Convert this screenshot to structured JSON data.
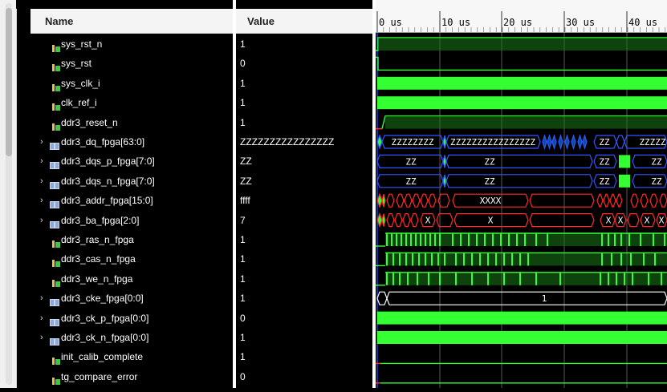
{
  "columns": {
    "name": "Name",
    "value": "Value"
  },
  "timeline": {
    "labels": [
      "0 us",
      "10 us",
      "20 us",
      "30 us",
      "40 us"
    ]
  },
  "signals": [
    {
      "name": "sys_rst_n",
      "value": "1",
      "kind": "bit",
      "expandable": false
    },
    {
      "name": "sys_rst",
      "value": "0",
      "kind": "bit",
      "expandable": false
    },
    {
      "name": "sys_clk_i",
      "value": "1",
      "kind": "bit",
      "expandable": false
    },
    {
      "name": "clk_ref_i",
      "value": "1",
      "kind": "bit",
      "expandable": false
    },
    {
      "name": "ddr3_reset_n",
      "value": "1",
      "kind": "bit",
      "expandable": false
    },
    {
      "name": "ddr3_dq_fpga[63:0]",
      "value": "ZZZZZZZZZZZZZZZZ",
      "kind": "bus",
      "expandable": true
    },
    {
      "name": "ddr3_dqs_p_fpga[7:0]",
      "value": "ZZ",
      "kind": "bus",
      "expandable": true
    },
    {
      "name": "ddr3_dqs_n_fpga[7:0]",
      "value": "ZZ",
      "kind": "bus",
      "expandable": true
    },
    {
      "name": "ddr3_addr_fpga[15:0]",
      "value": "ffff",
      "kind": "bus",
      "expandable": true
    },
    {
      "name": "ddr3_ba_fpga[2:0]",
      "value": "7",
      "kind": "bus",
      "expandable": true
    },
    {
      "name": "ddr3_ras_n_fpga",
      "value": "1",
      "kind": "bit",
      "expandable": false
    },
    {
      "name": "ddr3_cas_n_fpga",
      "value": "1",
      "kind": "bit",
      "expandable": false
    },
    {
      "name": "ddr3_we_n_fpga",
      "value": "1",
      "kind": "bit",
      "expandable": false
    },
    {
      "name": "ddr3_cke_fpga[0:0]",
      "value": "1",
      "kind": "bus",
      "expandable": true
    },
    {
      "name": "ddr3_ck_p_fpga[0:0]",
      "value": "0",
      "kind": "bus",
      "expandable": true
    },
    {
      "name": "ddr3_ck_n_fpga[0:0]",
      "value": "1",
      "kind": "bus",
      "expandable": true
    },
    {
      "name": "init_calib_complete",
      "value": "1",
      "kind": "bit",
      "expandable": false
    },
    {
      "name": "tg_compare_error",
      "value": "0",
      "kind": "bit",
      "expandable": false
    }
  ],
  "wave_labels": {
    "dq": [
      "ZZZZZZZZ",
      "ZZZZZZZZZZZZZZZZ",
      "ZZ",
      "ZZZZZ"
    ],
    "dqs_p": [
      "ZZ",
      "ZZ",
      "ZZ",
      "ZZ"
    ],
    "dqs_n": [
      "ZZ",
      "ZZ",
      "ZZ",
      "ZZ"
    ],
    "addr": [
      "XXXX"
    ],
    "ba": [
      "X",
      "X",
      "X",
      "X",
      "X",
      "X"
    ],
    "cke": [
      "1"
    ]
  },
  "colors": {
    "bright": "#33ff33",
    "dim": "#1a7a1a",
    "x_red": "#ff2a2a",
    "z_blue": "#3355ff",
    "cursor": "#2255ff"
  }
}
